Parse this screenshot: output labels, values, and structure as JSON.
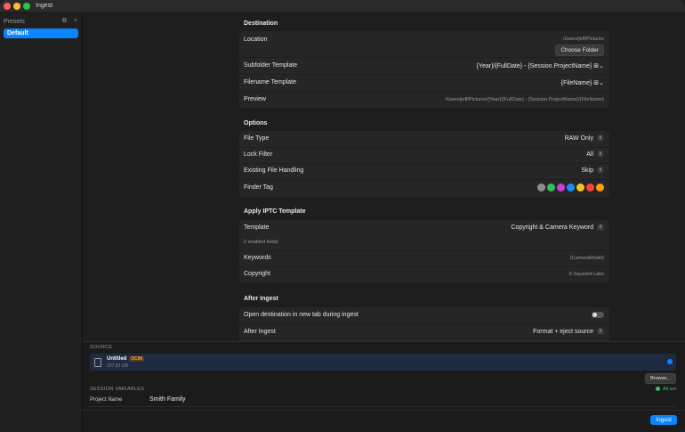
{
  "window": {
    "title": "Ingest"
  },
  "sidebar": {
    "heading": "Presets",
    "icons": [
      "duplicate-icon",
      "add-icon"
    ],
    "items": [
      {
        "label": "Default",
        "selected": true
      }
    ]
  },
  "destination": {
    "title": "Destination",
    "location_label": "Location",
    "location_path": "/Users/jeff/Pictures",
    "choose_folder": "Choose Folder",
    "subfolder_label": "Subfolder Template",
    "subfolder_value": "{Year}/{FullDate} - {Session.ProjectName}",
    "filename_label": "Filename Template",
    "filename_value": "{FileName}",
    "preview_label": "Preview",
    "preview_value": "/Users/jeff/Pictures/{Year}/{FullDate} - {Session.ProjectName}/{FileName}"
  },
  "options": {
    "title": "Options",
    "file_type_label": "File Type",
    "file_type_value": "RAW Only",
    "lock_filter_label": "Lock Filter",
    "lock_filter_value": "All",
    "existing_label": "Existing File Handling",
    "existing_value": "Skip",
    "finder_tag_label": "Finder Tag",
    "finder_tag_colors": [
      "#8e8e93",
      "#30c15a",
      "#c840d8",
      "#1a8cff",
      "#f5c518",
      "#ff453a",
      "#ff9f0a"
    ]
  },
  "iptc": {
    "title": "Apply IPTC Template",
    "template_label": "Template",
    "template_value": "Copyright & Camera Keyword",
    "enabled_fields": "2 enabled fields",
    "keywords_label": "Keywords",
    "keywords_value": "{CameraModel}",
    "copyright_label": "Copyright",
    "copyright_value": "X-Squared Labs"
  },
  "after": {
    "title": "After Ingest",
    "open_dest_label": "Open destination in new tab during ingest",
    "open_dest_on": false,
    "after_label": "After Ingest",
    "after_value": "Format + eject source"
  },
  "source": {
    "heading": "SOURCE",
    "name": "Untitled",
    "badge": "DCIM",
    "size": "107.83 GB",
    "browse": "Browse..."
  },
  "session": {
    "heading": "SESSION VARIABLES",
    "status": "All set",
    "project_label": "Project Name",
    "project_value": "Smith Family"
  },
  "footer": {
    "ingest": "Ingest"
  }
}
